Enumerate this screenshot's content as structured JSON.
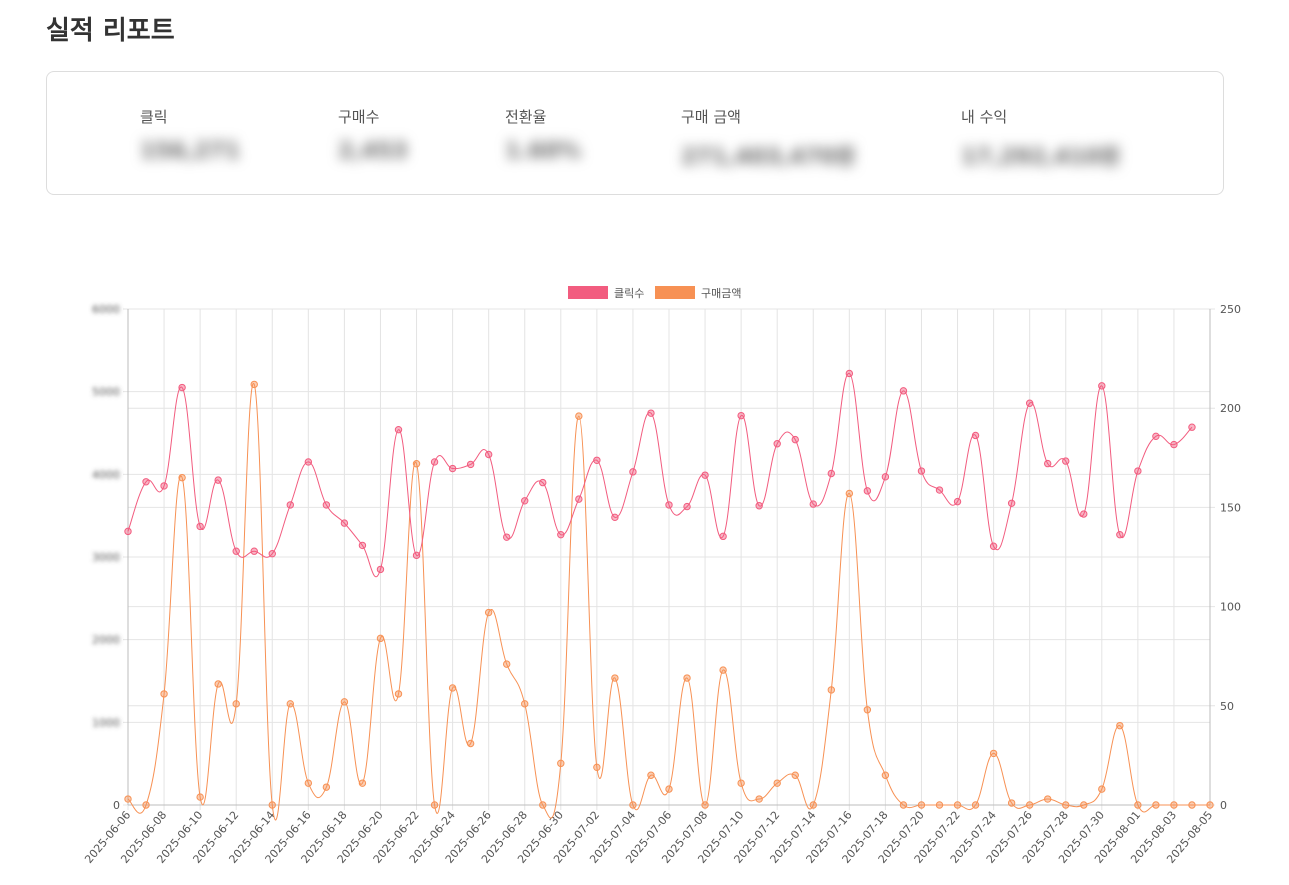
{
  "page": {
    "title": "실적 리포트"
  },
  "summary": {
    "click_label": "클릭",
    "click_value": "156,271",
    "purchases_label": "구매수",
    "purchases_value": "2,453",
    "conversion_label": "전환율",
    "conversion_value": "1.60%",
    "amount_label": "구매 금액",
    "amount_value": "271,403,470원",
    "revenue_label": "내 수익",
    "revenue_value": "17,292,410원"
  },
  "colors": {
    "clicks": "#f25c7f",
    "amount": "#f79154"
  },
  "chart_data": {
    "type": "line",
    "title": "",
    "legend_position": "top",
    "grid": true,
    "x": [
      "2025-06-06",
      "2025-06-07",
      "2025-06-08",
      "2025-06-09",
      "2025-06-10",
      "2025-06-11",
      "2025-06-12",
      "2025-06-13",
      "2025-06-14",
      "2025-06-15",
      "2025-06-16",
      "2025-06-17",
      "2025-06-18",
      "2025-06-19",
      "2025-06-20",
      "2025-06-21",
      "2025-06-22",
      "2025-06-23",
      "2025-06-24",
      "2025-06-25",
      "2025-06-26",
      "2025-06-27",
      "2025-06-28",
      "2025-06-29",
      "2025-06-30",
      "2025-07-01",
      "2025-07-02",
      "2025-07-03",
      "2025-07-04",
      "2025-07-05",
      "2025-07-06",
      "2025-07-07",
      "2025-07-08",
      "2025-07-09",
      "2025-07-10",
      "2025-07-11",
      "2025-07-12",
      "2025-07-13",
      "2025-07-14",
      "2025-07-15",
      "2025-07-16",
      "2025-07-17",
      "2025-07-18",
      "2025-07-19",
      "2025-07-20",
      "2025-07-21",
      "2025-07-22",
      "2025-07-23",
      "2025-07-24",
      "2025-07-25",
      "2025-07-26",
      "2025-07-27",
      "2025-07-28",
      "2025-07-29",
      "2025-07-30",
      "2025-07-31",
      "2025-08-01",
      "2025-08-02",
      "2025-08-03",
      "2025-08-04",
      "2025-08-05"
    ],
    "x_tick_labels": [
      "2025-06-06",
      "2025-06-08",
      "2025-06-10",
      "2025-06-12",
      "2025-06-14",
      "2025-06-16",
      "2025-06-18",
      "2025-06-20",
      "2025-06-22",
      "2025-06-24",
      "2025-06-26",
      "2025-06-28",
      "2025-06-30",
      "2025-07-02",
      "2025-07-04",
      "2025-07-06",
      "2025-07-08",
      "2025-07-10",
      "2025-07-12",
      "2025-07-14",
      "2025-07-16",
      "2025-07-18",
      "2025-07-20",
      "2025-07-22",
      "2025-07-24",
      "2025-07-26",
      "2025-07-28",
      "2025-07-30",
      "2025-08-01",
      "2025-08-03",
      "2025-08-05"
    ],
    "y_left": {
      "ylim": [
        0,
        6000
      ],
      "ticks": [
        0,
        1000,
        2000,
        3000,
        4000,
        5000,
        6000
      ],
      "tick_labels": [
        "0",
        "1000",
        "2000",
        "3000",
        "4000",
        "5000",
        "6000"
      ],
      "label_blurred": true
    },
    "y_right": {
      "ylim": [
        0,
        250
      ],
      "ticks": [
        0,
        50,
        100,
        150,
        200,
        250
      ],
      "tick_labels": [
        "0",
        "50",
        "100",
        "150",
        "200",
        "250"
      ]
    },
    "series": [
      {
        "name": "클릭수",
        "axis": "left",
        "color": "#f25c7f",
        "values": [
          3310,
          3910,
          3860,
          5050,
          3370,
          3930,
          3070,
          3070,
          3040,
          3630,
          4150,
          3630,
          3410,
          3140,
          2850,
          4540,
          3020,
          4150,
          4070,
          4120,
          4240,
          3240,
          3680,
          3900,
          3270,
          3700,
          4170,
          3480,
          4030,
          4740,
          3630,
          3610,
          3990,
          3250,
          4710,
          3620,
          4370,
          4420,
          3640,
          4010,
          5220,
          3800,
          3970,
          5010,
          4040,
          3810,
          3670,
          4470,
          3130,
          3650,
          4860,
          4130,
          4160,
          3520,
          5070,
          3270,
          4040,
          4460,
          4360,
          4570
        ]
      },
      {
        "name": "구매금액",
        "axis": "right",
        "color": "#f79154",
        "values": [
          3,
          0,
          56,
          165,
          4,
          61,
          51,
          212,
          0,
          51,
          11,
          9,
          52,
          11,
          84,
          56,
          172,
          0,
          59,
          31,
          97,
          71,
          51,
          0,
          21,
          196,
          19,
          64,
          0,
          15,
          8,
          64,
          0,
          68,
          11,
          3,
          11,
          15,
          0,
          58,
          157,
          48,
          15,
          0,
          0,
          0,
          0,
          0,
          26,
          1,
          0,
          3,
          0,
          0,
          8,
          40,
          0,
          0,
          0,
          0,
          0
        ]
      }
    ]
  }
}
